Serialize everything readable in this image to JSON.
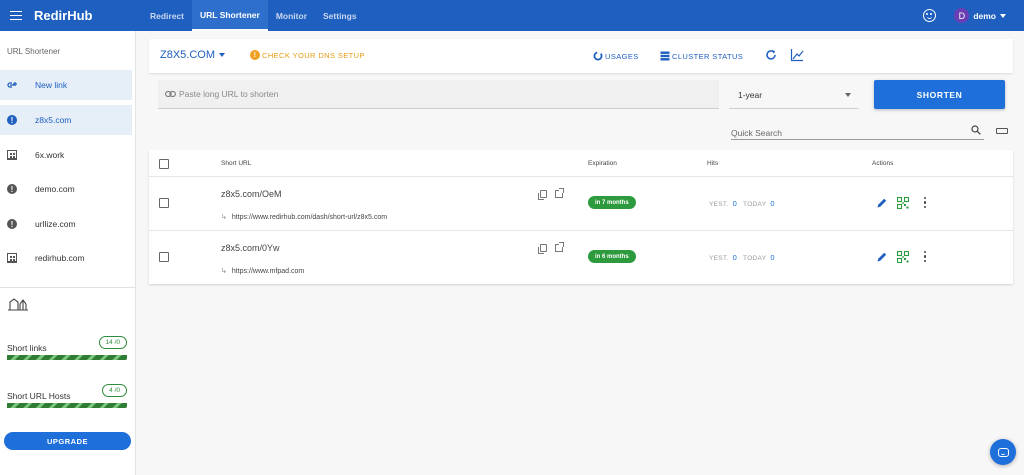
{
  "topbar": {
    "brand": "RedirHub",
    "tabs": [
      {
        "label": "Redirect"
      },
      {
        "label": "URL Shortener"
      },
      {
        "label": "Monitor"
      },
      {
        "label": "Settings"
      }
    ],
    "avatar_letter": "D",
    "username": "demo"
  },
  "sidebar": {
    "heading": "URL Shortener",
    "items": [
      {
        "label": "New link",
        "icon": "new-link-icon"
      },
      {
        "label": "z8x5.com",
        "icon": "alert-icon"
      },
      {
        "label": "6x.work",
        "icon": "building-icon"
      },
      {
        "label": "demo.com",
        "icon": "alert-icon"
      },
      {
        "label": "urllize.com",
        "icon": "alert-icon"
      },
      {
        "label": "redirhub.com",
        "icon": "building-icon"
      }
    ],
    "quotas": [
      {
        "label": "Short links",
        "badge": "14 /0",
        "fill_percent": 100
      },
      {
        "label": "Short URL Hosts",
        "badge": "4 /0",
        "fill_percent": 100
      }
    ],
    "upgrade_label": "UPGRADE"
  },
  "toolbar": {
    "domain": "Z8X5.COM",
    "dns_warning": "CHECK YOUR DNS SETUP",
    "usages": "USAGES",
    "cluster_status": "CLUSTER STATUS"
  },
  "shortener": {
    "placeholder": "Paste long URL to shorten",
    "expiry": "1-year",
    "button": "SHORTEN"
  },
  "search": {
    "placeholder": "Quick Search"
  },
  "table": {
    "headers": {
      "short_url": "Short URL",
      "expiration": "Expiration",
      "hits": "Hits",
      "actions": "Actions"
    },
    "rows": [
      {
        "short_url": "z8x5.com/OeM",
        "long_url": "https://www.redirhub.com/dash/short-url/z8x5.com",
        "expiration": "in 7 months",
        "yest_label": "YEST.",
        "yest": "0",
        "today_label": "TODAY",
        "today": "0"
      },
      {
        "short_url": "z8x5.com/0Yw",
        "long_url": "https://www.mfpad.com",
        "expiration": "in 6 months",
        "yest_label": "YEST.",
        "yest": "0",
        "today_label": "TODAY",
        "today": "0"
      }
    ]
  },
  "colors": {
    "primary": "#1e5fbf",
    "button": "#1e6fd9",
    "warning": "#e69a12",
    "success": "#2e9a3e"
  }
}
